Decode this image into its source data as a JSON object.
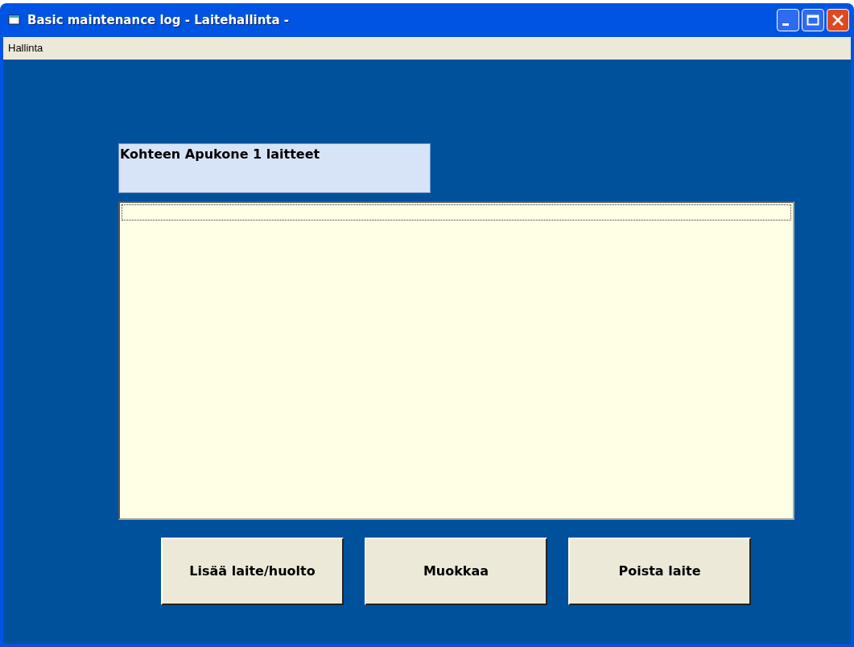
{
  "window": {
    "title": "Basic maintenance log - Laitehallinta -"
  },
  "menu": [
    {
      "label": "Hallinta"
    }
  ],
  "heading": "Kohteen Apukone 1 laitteet",
  "buttons": [
    {
      "label": "Lisää laite/huolto"
    },
    {
      "label": "Muokkaa"
    },
    {
      "label": "Poista laite"
    }
  ]
}
